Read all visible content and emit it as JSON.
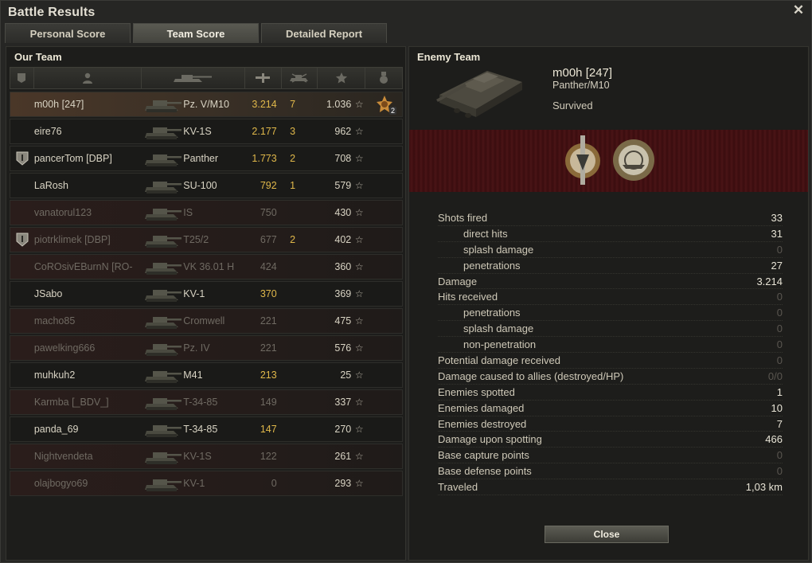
{
  "window": {
    "title": "Battle Results",
    "close_glyph": "✕"
  },
  "tabs": [
    {
      "label": "Personal Score",
      "active": false
    },
    {
      "label": "Team Score",
      "active": true
    },
    {
      "label": "Detailed Report",
      "active": false
    }
  ],
  "our_team": {
    "label": "Our Team",
    "columns": [
      "platoon-icon",
      "player-icon",
      "vehicle-icon",
      "damage-icon",
      "kills-icon",
      "xp-star-icon",
      "achievement-icon"
    ],
    "rows": [
      {
        "name": "m00h [247]",
        "vehicle": "Pz. V/M10",
        "damage": "3.214",
        "kills": "7",
        "xp": "1.036",
        "star": "☆",
        "badge": "",
        "achievement": "2",
        "state": "self"
      },
      {
        "name": "eire76",
        "vehicle": "KV-1S",
        "damage": "2.177",
        "kills": "3",
        "xp": "962",
        "star": "☆",
        "badge": "",
        "achievement": "",
        "state": "alive"
      },
      {
        "name": "pancerTom [DBP]",
        "vehicle": "Panther",
        "damage": "1.773",
        "kills": "2",
        "xp": "708",
        "star": "☆",
        "badge": "I",
        "achievement": "",
        "state": "alive"
      },
      {
        "name": "LaRosh",
        "vehicle": "SU-100",
        "damage": "792",
        "kills": "1",
        "xp": "579",
        "star": "☆",
        "badge": "",
        "achievement": "",
        "state": "alive"
      },
      {
        "name": "vanatorul123",
        "vehicle": "IS",
        "damage": "750",
        "kills": "",
        "xp": "430",
        "star": "☆",
        "badge": "",
        "achievement": "",
        "state": "dead"
      },
      {
        "name": "piotrklimek [DBP]",
        "vehicle": "T25/2",
        "damage": "677",
        "kills": "2",
        "xp": "402",
        "star": "☆",
        "badge": "I",
        "achievement": "",
        "state": "dead"
      },
      {
        "name": "CoROsivEBurnN [RO-",
        "vehicle": "VK 36.01 H",
        "damage": "424",
        "kills": "",
        "xp": "360",
        "star": "☆",
        "badge": "",
        "achievement": "",
        "state": "dead"
      },
      {
        "name": "JSabo",
        "vehicle": "KV-1",
        "damage": "370",
        "kills": "",
        "xp": "369",
        "star": "☆",
        "badge": "",
        "achievement": "",
        "state": "alive"
      },
      {
        "name": "macho85",
        "vehicle": "Cromwell",
        "damage": "221",
        "kills": "",
        "xp": "475",
        "star": "☆",
        "badge": "",
        "achievement": "",
        "state": "dead"
      },
      {
        "name": "pawelking666",
        "vehicle": "Pz. IV",
        "damage": "221",
        "kills": "",
        "xp": "576",
        "star": "☆",
        "badge": "",
        "achievement": "",
        "state": "dead"
      },
      {
        "name": "muhkuh2",
        "vehicle": "M41",
        "damage": "213",
        "kills": "",
        "xp": "25",
        "star": "☆",
        "badge": "",
        "achievement": "",
        "state": "alive"
      },
      {
        "name": "Karmba [_BDV_]",
        "vehicle": "T-34-85",
        "damage": "149",
        "kills": "",
        "xp": "337",
        "star": "☆",
        "badge": "",
        "achievement": "",
        "state": "dead"
      },
      {
        "name": "panda_69",
        "vehicle": "T-34-85",
        "damage": "147",
        "kills": "",
        "xp": "270",
        "star": "☆",
        "badge": "",
        "achievement": "",
        "state": "alive"
      },
      {
        "name": "Nightvendeta",
        "vehicle": "KV-1S",
        "damage": "122",
        "kills": "",
        "xp": "261",
        "star": "☆",
        "badge": "",
        "achievement": "",
        "state": "dead"
      },
      {
        "name": "olajbogyo69",
        "vehicle": "KV-1",
        "damage": "0",
        "kills": "",
        "xp": "293",
        "star": "☆",
        "badge": "",
        "achievement": "",
        "state": "dead"
      }
    ]
  },
  "detail": {
    "team_label": "Enemy Team",
    "player_name": "m00h [247]",
    "vehicle": "Panther/M10",
    "status": "Survived",
    "medals": [
      "tank-expert-medal-icon",
      "sniper-medal-icon"
    ],
    "stats": [
      {
        "label": "Shots fired",
        "value": "33",
        "sub": false,
        "zero": false
      },
      {
        "label": "direct hits",
        "value": "31",
        "sub": true,
        "zero": false
      },
      {
        "label": "splash damage",
        "value": "0",
        "sub": true,
        "zero": true
      },
      {
        "label": "penetrations",
        "value": "27",
        "sub": true,
        "zero": false
      },
      {
        "label": "Damage",
        "value": "3.214",
        "sub": false,
        "zero": false
      },
      {
        "label": "Hits received",
        "value": "0",
        "sub": false,
        "zero": true
      },
      {
        "label": "penetrations",
        "value": "0",
        "sub": true,
        "zero": true
      },
      {
        "label": "splash damage",
        "value": "0",
        "sub": true,
        "zero": true
      },
      {
        "label": "non-penetration",
        "value": "0",
        "sub": true,
        "zero": true
      },
      {
        "label": "Potential damage received",
        "value": "0",
        "sub": false,
        "zero": true
      },
      {
        "label": "Damage caused to allies (destroyed/HP)",
        "value": "0/0",
        "sub": false,
        "zero": true
      },
      {
        "label": "Enemies spotted",
        "value": "1",
        "sub": false,
        "zero": false
      },
      {
        "label": "Enemies damaged",
        "value": "10",
        "sub": false,
        "zero": false
      },
      {
        "label": "Enemies destroyed",
        "value": "7",
        "sub": false,
        "zero": false
      },
      {
        "label": "Damage upon spotting",
        "value": "466",
        "sub": false,
        "zero": false
      },
      {
        "label": "Base capture points",
        "value": "0",
        "sub": false,
        "zero": true
      },
      {
        "label": "Base defense points",
        "value": "0",
        "sub": false,
        "zero": true
      },
      {
        "label": "Traveled",
        "value": "1,03 km",
        "sub": false,
        "zero": false
      }
    ],
    "close_label": "Close"
  },
  "colors": {
    "accent_damage": "#e0b84a",
    "dead_row": "#2a1d1b",
    "self_row": "#4a3728",
    "medal_band": "#4a1416"
  }
}
